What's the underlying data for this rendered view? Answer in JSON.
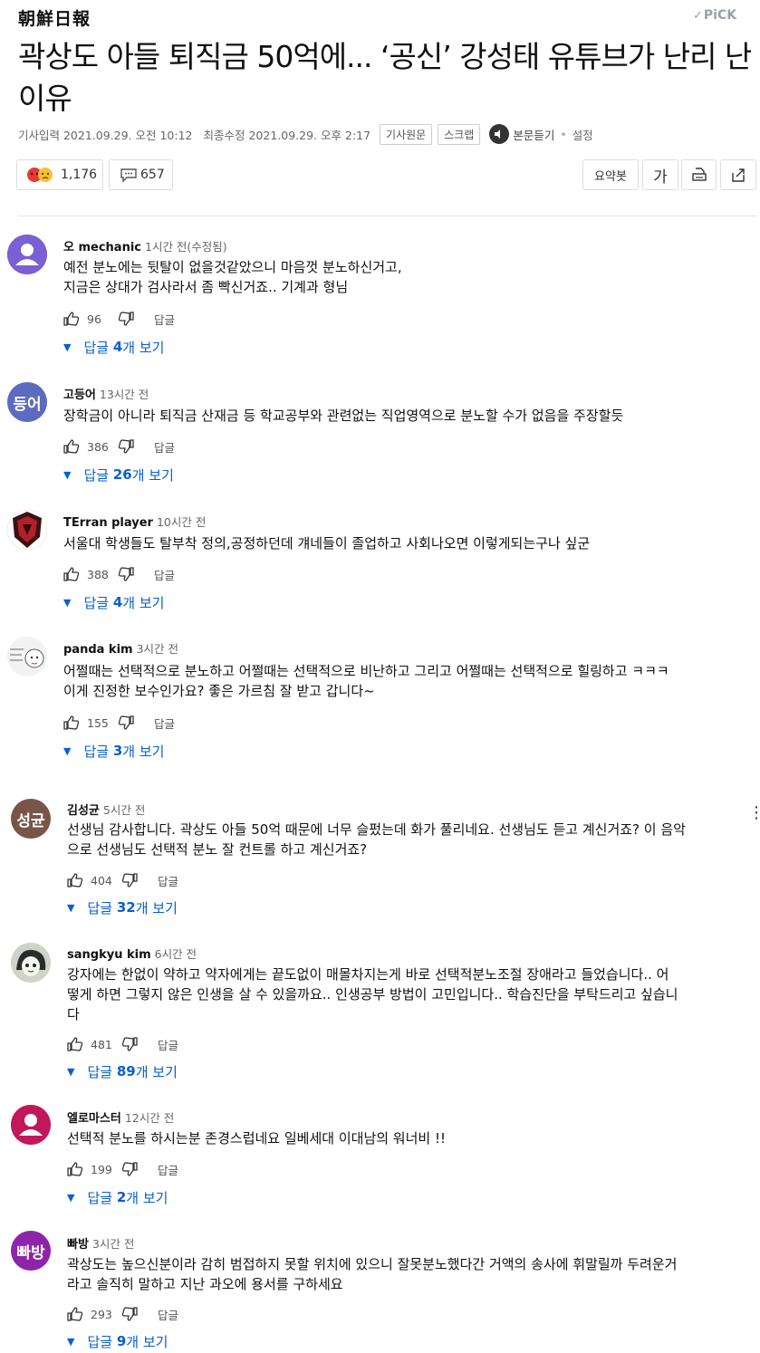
{
  "header": {
    "logo": "朝鮮日報",
    "pick_check": "✓",
    "pick": "PiCK"
  },
  "article": {
    "title": "곽상도 아들 퇴직금 50억에... ‘공신’ 강성태 유튜브가 난리 난 이유",
    "published": "기사입력 2021.09.29. 오전 10:12",
    "modified": "최종수정 2021.09.29. 오후 2:17",
    "chips": [
      "기사원문",
      "스크랩"
    ],
    "listen": "본문듣기",
    "settings": "설정"
  },
  "toolbar": {
    "reaction_count": "1,176",
    "comment_count": "657",
    "summary_label": "요약봇",
    "font_label": "가"
  },
  "comments": [
    {
      "name": "오 mechanic",
      "time": "1시간 전(수정됨)",
      "text": "예전 분노에는 뒷탈이 없을것같았으니 마음껏 분노하신거고,\n지금은 상대가 검사라서 좀 빡신거죠.. 기계과 형님",
      "likes": "96",
      "reply_label": "답글",
      "replies_prefix": "답글 ",
      "replies_count": "4",
      "replies_suffix": "개 보기",
      "avatar": "person-icon",
      "avatar_color": "#7b5fd4"
    },
    {
      "name": "고등어",
      "time": "13시간 전",
      "text": "장학금이 아니라 퇴직금 산재금 등 학교공부와 관련없는 직업영역으로 분노할 수가 없음을 주장할듯",
      "likes": "386",
      "reply_label": "답글",
      "replies_prefix": "답글 ",
      "replies_count": "26",
      "replies_suffix": "개 보기",
      "avatar_text": "등어",
      "avatar_color": "#5c6bc0"
    },
    {
      "name": "TErran player",
      "time": "10시간 전",
      "text": "서울대 학생들도 탈부착 정의,공정하던데 걔네들이 졸업하고 사회나오면 이렇게되는구나 싶군",
      "likes": "388",
      "reply_label": "답글",
      "replies_prefix": "답글 ",
      "replies_count": "4",
      "replies_suffix": "개 보기",
      "avatar": "shield-emblem-icon",
      "avatar_color": "#b3202a"
    },
    {
      "name": "panda kim",
      "time": "3시간 전",
      "text": "어쩔때는 선택적으로 분노하고 어쩔때는 선택적으로 비난하고 그리고 어쩔때는 선택적으로 힐링하고 ㅋㅋㅋ\n이게 진정한 보수인가요? 좋은 가르침 잘 받고 갑니다~",
      "likes": "155",
      "reply_label": "답글",
      "replies_prefix": "답글 ",
      "replies_count": "3",
      "replies_suffix": "개 보기",
      "avatar": "sketch-face-icon",
      "avatar_color": "#f2f2f2"
    },
    {
      "name": "김성균",
      "time": "5시간 전",
      "text": "선생님 감사합니다. 곽상도 아들 50억 때문에 너무 슬펐는데 화가 풀리네요. 선생님도 듣고 계신거죠? 이 음악\n으로 선생님도 선택적 분노 잘 컨트롤 하고 계신거죠?",
      "likes": "404",
      "reply_label": "답글",
      "replies_prefix": "답글 ",
      "replies_count": "32",
      "replies_suffix": "개 보기",
      "avatar_text": "성균",
      "avatar_color": "#795548"
    },
    {
      "name": "sangkyu kim",
      "time": "6시간 전",
      "text": "강자에는 한없이 약하고 약자에게는 끝도없이 매몰차지는게 바로 선택적분노조절 장애라고 들었습니다.. 어\n떻게 하면 그렇지 않은 인생을 살 수 있을까요.. 인생공부 방법이 고민입니다.. 학습진단을 부탁드리고 싶습니\n다",
      "likes": "481",
      "reply_label": "답글",
      "replies_prefix": "답글 ",
      "replies_count": "89",
      "replies_suffix": "개 보기",
      "avatar": "cartoon-face-icon",
      "avatar_color": "#cfd4c8"
    },
    {
      "name": "엘로마스터",
      "time": "12시간 전",
      "text": "선택적 분노를 하시는분 존경스럽네요 일베세대 이대남의 워너비 !!",
      "likes": "199",
      "reply_label": "답글",
      "replies_prefix": "답글 ",
      "replies_count": "2",
      "replies_suffix": "개 보기",
      "avatar": "person-icon",
      "avatar_color": "#c2185b"
    },
    {
      "name": "빠방",
      "time": "3시간 전",
      "text": "곽상도는 높으신분이라 감히 범접하지 못할 위치에 있으니 잘못분노했다간 거액의 송사에 휘말릴까 두려운거\n라고 솔직히 말하고 지난 과오에 용서를 구하세요",
      "likes": "293",
      "reply_label": "답글",
      "replies_prefix": "답글 ",
      "replies_count": "9",
      "replies_suffix": "개 보기",
      "avatar_text": "빠방",
      "avatar_color": "#8e24aa"
    }
  ],
  "colors": {
    "link_blue": "#065fd4",
    "text": "#111111",
    "muted": "#666666"
  }
}
